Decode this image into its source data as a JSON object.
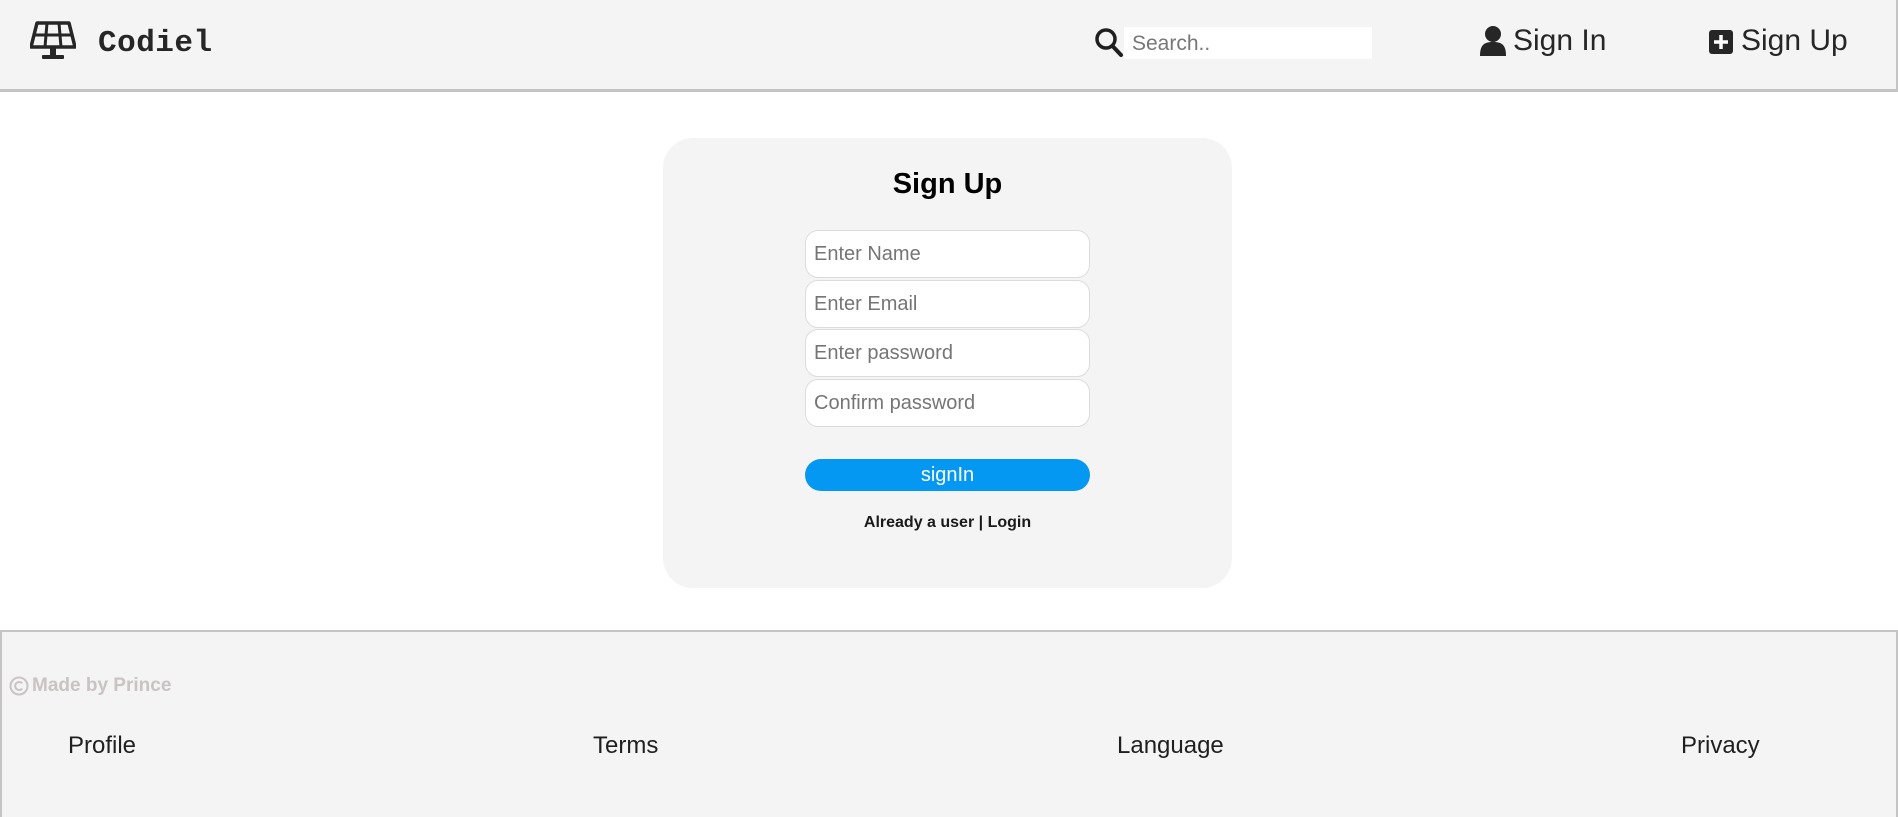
{
  "header": {
    "brand": {
      "name": "Codiel",
      "icon": "solar-panel-icon"
    },
    "search": {
      "placeholder": "Search..",
      "value": "",
      "icon": "search-icon"
    },
    "nav": [
      {
        "label": "Sign In",
        "icon": "user-icon"
      },
      {
        "label": "Sign Up",
        "icon": "plus-square-icon"
      }
    ]
  },
  "form": {
    "title": "Sign Up",
    "fields": [
      {
        "placeholder": "Enter Name",
        "value": ""
      },
      {
        "placeholder": "Enter Email",
        "value": ""
      },
      {
        "placeholder": "Enter password",
        "value": ""
      },
      {
        "placeholder": "Confirm password",
        "value": ""
      }
    ],
    "submit_label": "signIn",
    "already_text": "Already a user",
    "separator": "|",
    "login_label": "Login"
  },
  "footer": {
    "copyright": "Made by Prince",
    "links": [
      "Profile",
      "Terms",
      "Language",
      "Privacy"
    ]
  },
  "colors": {
    "accent": "#0598f2",
    "panel_bg": "#f4f4f4",
    "border": "#c4c4c4",
    "muted_text": "#c9c3c3"
  }
}
